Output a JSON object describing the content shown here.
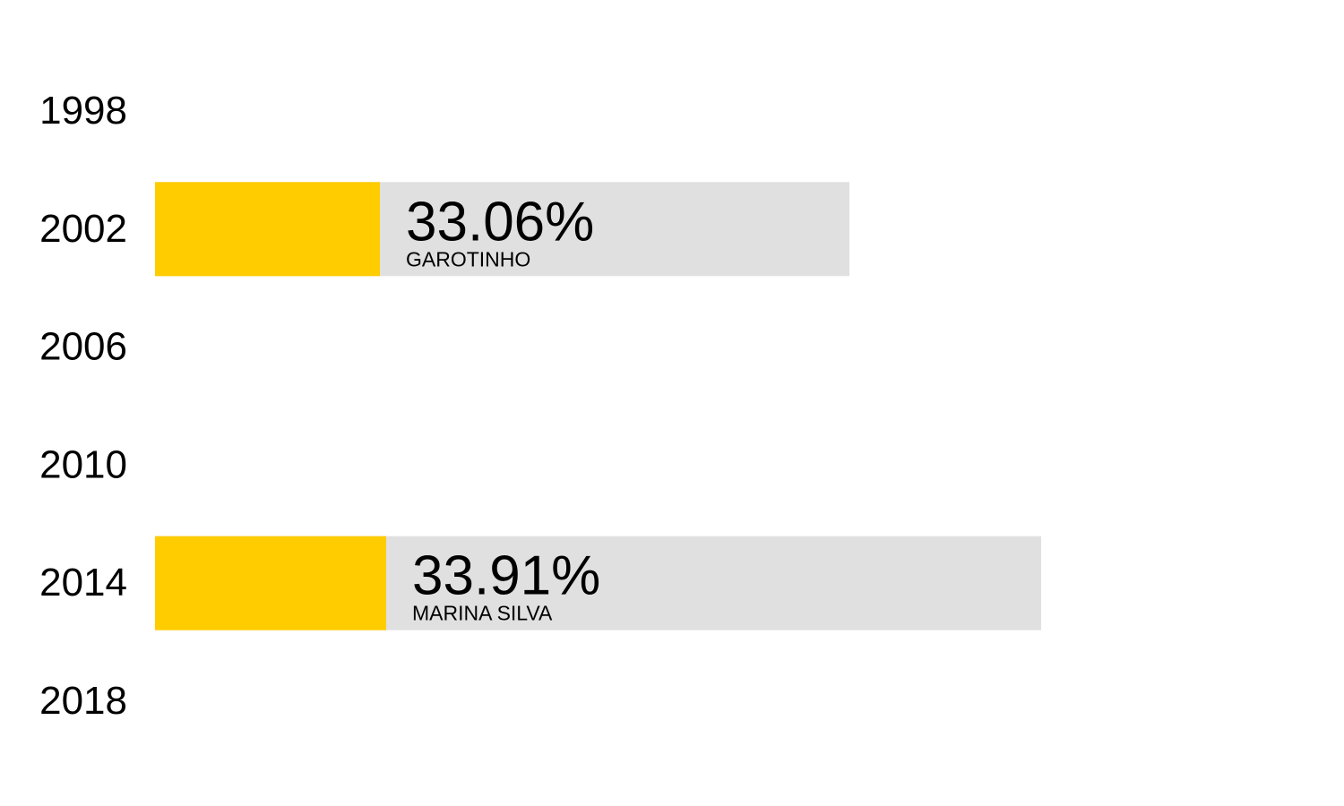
{
  "chart_data": {
    "type": "bar",
    "orientation": "horizontal",
    "categories": [
      "1998",
      "2002",
      "2006",
      "2010",
      "2014",
      "2018"
    ],
    "bars": [
      {
        "category": "2002",
        "value": 33.06,
        "value_label": "33.06%",
        "candidate": "GAROTINHO"
      },
      {
        "category": "2014",
        "value": 33.91,
        "value_label": "33.91%",
        "candidate": "MARINA SILVA"
      }
    ],
    "colors": {
      "highlight": "#ffcc00",
      "track": "#e0e0e0",
      "text": "#000000"
    }
  }
}
